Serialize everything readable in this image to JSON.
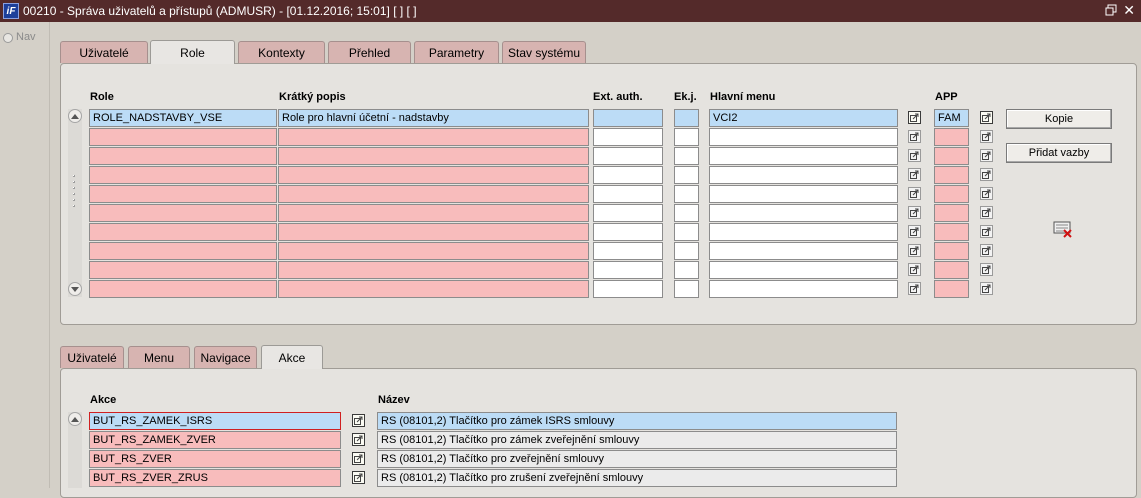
{
  "window": {
    "title": "00210 - Správa uživatelů a přístupů (ADMUSR) - [01.12.2016; 15:01] [ ] [ ]"
  },
  "nav": {
    "label": "Nav"
  },
  "top_tabs": [
    "Uživatelé",
    "Role",
    "Kontexty",
    "Přehled",
    "Parametry",
    "Stav systému"
  ],
  "roles_block": {
    "headers": {
      "role": "Role",
      "desc": "Krátký popis",
      "ext": "Ext. auth.",
      "ekj": "Ek.j.",
      "menu": "Hlavní menu",
      "app": "APP"
    },
    "rows": [
      {
        "role": "ROLE_NADSTAVBY_VSE",
        "desc": "Role pro hlavní účetní - nadstavby",
        "ext": "",
        "ekj": "",
        "menu": "VCI2",
        "app": "FAM"
      },
      {
        "role": "",
        "desc": "",
        "ext": "",
        "ekj": "",
        "menu": "",
        "app": ""
      },
      {
        "role": "",
        "desc": "",
        "ext": "",
        "ekj": "",
        "menu": "",
        "app": ""
      },
      {
        "role": "",
        "desc": "",
        "ext": "",
        "ekj": "",
        "menu": "",
        "app": ""
      },
      {
        "role": "",
        "desc": "",
        "ext": "",
        "ekj": "",
        "menu": "",
        "app": ""
      },
      {
        "role": "",
        "desc": "",
        "ext": "",
        "ekj": "",
        "menu": "",
        "app": ""
      },
      {
        "role": "",
        "desc": "",
        "ext": "",
        "ekj": "",
        "menu": "",
        "app": ""
      },
      {
        "role": "",
        "desc": "",
        "ext": "",
        "ekj": "",
        "menu": "",
        "app": ""
      },
      {
        "role": "",
        "desc": "",
        "ext": "",
        "ekj": "",
        "menu": "",
        "app": ""
      },
      {
        "role": "",
        "desc": "",
        "ext": "",
        "ekj": "",
        "menu": "",
        "app": ""
      }
    ],
    "buttons": {
      "copy": "Kopie",
      "add_links": "Přidat vazby"
    }
  },
  "bottom_tabs": [
    "Uživatelé",
    "Menu",
    "Navigace",
    "Akce"
  ],
  "actions_block": {
    "headers": {
      "action": "Akce",
      "name": "Název"
    },
    "rows": [
      {
        "action": "BUT_RS_ZAMEK_ISRS",
        "name": "RS (08101,2) Tlačítko pro zámek ISRS smlouvy"
      },
      {
        "action": "BUT_RS_ZAMEK_ZVER",
        "name": "RS (08101,2) Tlačítko pro zámek zveřejnění smlouvy"
      },
      {
        "action": "BUT_RS_ZVER",
        "name": "RS (08101,2) Tlačítko pro zveřejnění smlouvy"
      },
      {
        "action": "BUT_RS_ZVER_ZRUS",
        "name": "RS (08101,2) Tlačítko pro zrušení zveřejnění smlouvy"
      }
    ]
  },
  "colors": {
    "title_bar": "#542a2a",
    "required_field": "#f8bcbc",
    "selected_row": "#bcdcf6",
    "tab": "#d7b4b1",
    "panel": "#e5e3df"
  }
}
